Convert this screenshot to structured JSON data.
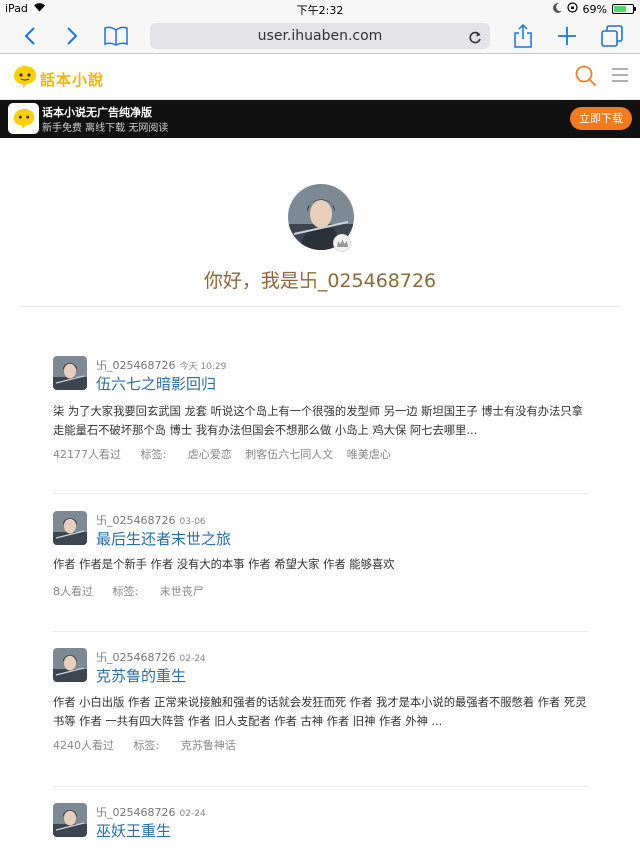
{
  "status_bar": {
    "device": "iPad",
    "time": "下午2:32",
    "battery": "69%",
    "battery_level": 0.69
  },
  "browser": {
    "url": "user.ihuaben.com"
  },
  "site": {
    "logo_text": "話本小說"
  },
  "banner": {
    "title": "话本小说无广告纯净版",
    "subtitle": "新手免费  离线下载  无网阅读",
    "download_label": "立即下载"
  },
  "profile": {
    "greeting": "你好，我是卐_025468726"
  },
  "feed": [
    {
      "author": "卐_025468726",
      "time": "今天 10:29",
      "title": "伍六七之暗影回归",
      "desc": "柒 为了大家我要回玄武国 龙套 听说这个岛上有一个很强的发型师 另一边 斯坦国王子 博士有没有办法只拿走能量石不破坏那个岛 博士 我有办法但国会不想那么做 小岛上 鸡大保 阿七去哪里...",
      "views": "42177人看过",
      "tag_label": "标签:",
      "tags": [
        "虐心爱恋",
        "刺客伍六七同人文",
        "唯美虐心"
      ]
    },
    {
      "author": "卐_025468726",
      "time": "03-06",
      "title": "最后生还者末世之旅",
      "desc": "作者 作者是个新手 作者 没有大的本事 作者 希望大家 作者 能够喜欢",
      "views": "8人看过",
      "tag_label": "标签:",
      "tags": [
        "末世丧尸"
      ]
    },
    {
      "author": "卐_025468726",
      "time": "02-24",
      "title": "克苏鲁的重生",
      "desc": "作者 小白出版 作者 正常来说接触和强者的话就会发狂而死 作者 我才是本小说的最强者不服憋着 作者 死灵书等 作者 一共有四大阵营 作者 旧人支配者 作者 古神 作者 旧神 作者 外神 ...",
      "views": "4240人看过",
      "tag_label": "标签:",
      "tags": [
        "克苏鲁神话"
      ]
    },
    {
      "author": "卐_025468726",
      "time": "02-24",
      "title": "巫妖王重生"
    }
  ]
}
